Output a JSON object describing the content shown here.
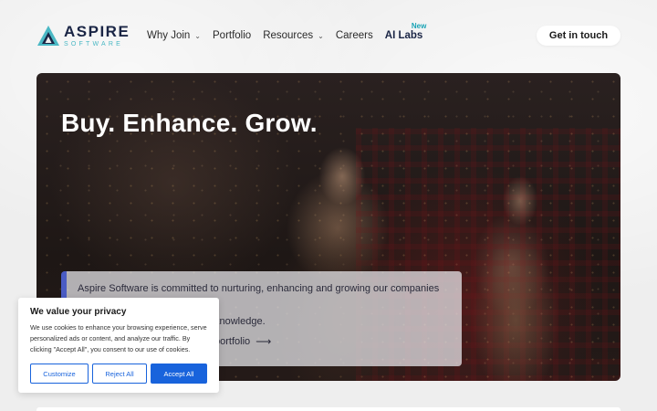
{
  "header": {
    "logo_name": "ASPIRE",
    "logo_sub": "SOFTWARE",
    "nav": [
      {
        "label": "Why Join",
        "has_dropdown": true
      },
      {
        "label": "Portfolio",
        "has_dropdown": false
      },
      {
        "label": "Resources",
        "has_dropdown": true
      },
      {
        "label": "Careers",
        "has_dropdown": false
      },
      {
        "label": "AI Labs",
        "has_dropdown": false,
        "badge": "New"
      }
    ],
    "cta_label": "Get in touch"
  },
  "hero": {
    "title": "Buy. Enhance. Grow.",
    "description": "Aspire Software is committed to nurturing, enhancing and growing our companies by",
    "description_visible_tail": "knowledge.",
    "link_label": "portfolio",
    "link_arrow": "⟶"
  },
  "cookie": {
    "title": "We value your privacy",
    "text": "We use cookies to enhance your browsing experience, serve personalized ads or content, and analyze our traffic. By clicking \"Accept All\", you consent to our use of cookies.",
    "customize_label": "Customize",
    "reject_label": "Reject All",
    "accept_label": "Accept All"
  },
  "colors": {
    "brand_navy": "#1a2545",
    "brand_teal": "#4ab8c4",
    "accent_blue": "#1863dc",
    "card_border": "#4a5cc4"
  }
}
